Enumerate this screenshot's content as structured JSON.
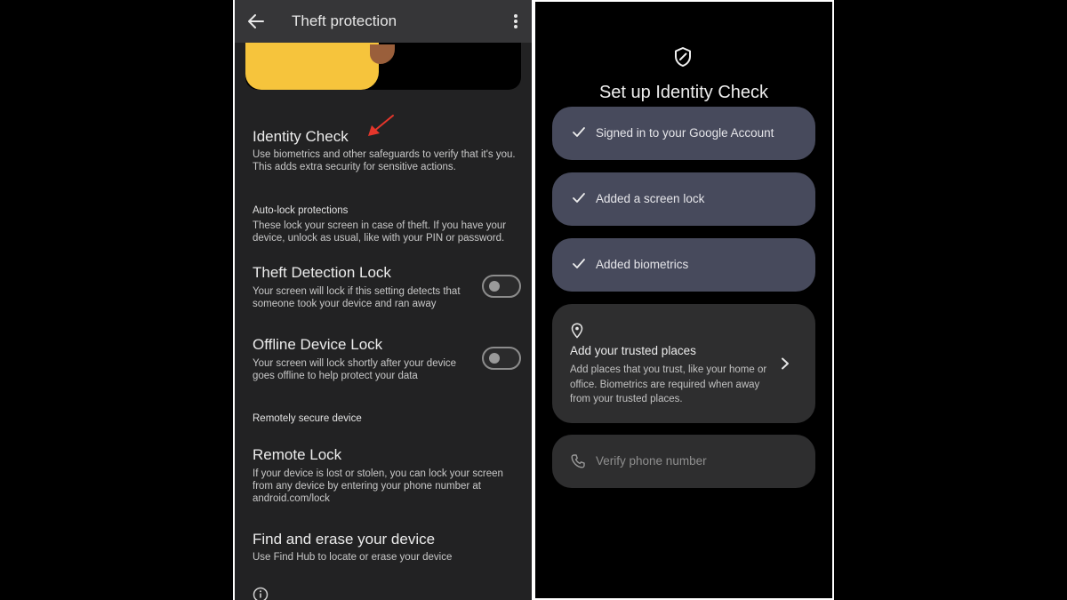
{
  "left_screen": {
    "app_bar": {
      "title": "Theft protection"
    },
    "identity_check": {
      "title": "Identity Check",
      "subtitle_line1": "Use biometrics and other safeguards to verify that it's you.",
      "subtitle_line2": "This adds extra security for sensitive actions."
    },
    "autolock": {
      "heading": "Auto-lock protections",
      "desc_line1": "These lock your screen in case of theft. If you have your",
      "desc_line2": "device, unlock as usual, like with your PIN or password."
    },
    "theft_detection": {
      "title": "Theft Detection Lock",
      "sub_line1": "Your screen will lock if this setting detects that",
      "sub_line2": "someone took your device and ran away",
      "enabled": false
    },
    "offline_lock": {
      "title": "Offline Device Lock",
      "sub_line1": "Your screen will lock shortly after your device",
      "sub_line2": "goes offline to help protect your data",
      "enabled": false
    },
    "remote_section": {
      "heading": "Remotely secure device"
    },
    "remote_lock": {
      "title": "Remote Lock",
      "sub_line1": "If your device is lost or stolen, you can lock your screen",
      "sub_line2": "from any device by entering your phone number at",
      "sub_line3": "android.com/lock"
    },
    "find_erase": {
      "title": "Find and erase your device",
      "sub": "Use Find Hub to locate or erase your device"
    },
    "annotation_color": "#e5362b"
  },
  "right_screen": {
    "title": "Set up Identity Check",
    "steps": [
      {
        "label": "Signed in to your Google Account",
        "done": true
      },
      {
        "label": "Added a screen lock",
        "done": true
      },
      {
        "label": "Added biometrics",
        "done": true
      }
    ],
    "trusted_places": {
      "title": "Add your trusted places",
      "desc": "Add places that you trust, like your home or office. Biometrics are required when away from your trusted places."
    },
    "verify_phone": {
      "label": "Verify phone number"
    },
    "completed_step_color": "#474a5c"
  }
}
